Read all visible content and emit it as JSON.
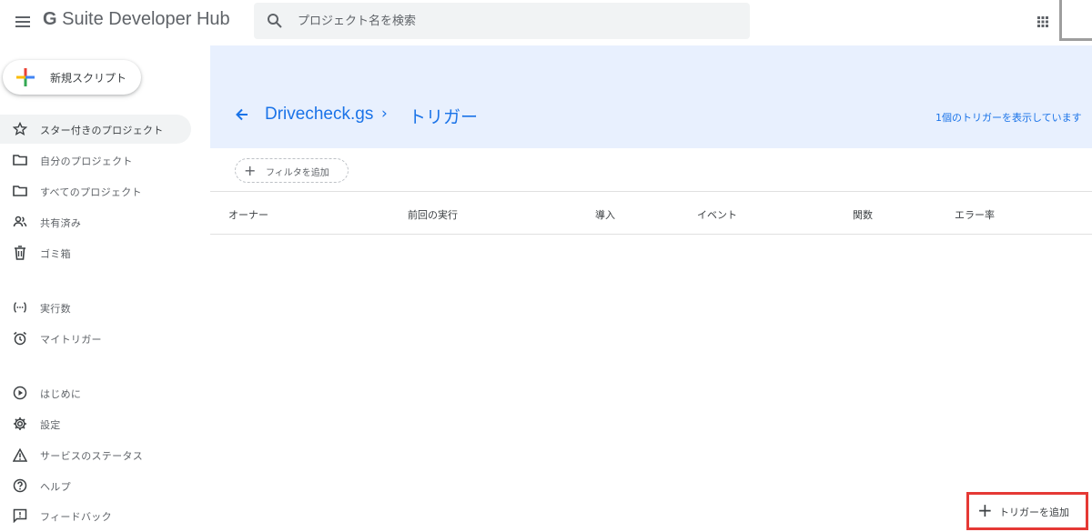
{
  "header": {
    "app_title_g": "G",
    "app_title_rest": "Suite Developer Hub",
    "search_placeholder": "プロジェクト名を検索",
    "icons": {
      "menu": "menu-icon",
      "search": "search-icon",
      "apps": "apps-grid-icon"
    }
  },
  "sidebar": {
    "new_script_label": "新規スクリプト",
    "items": [
      {
        "label": "スター付きのプロジェクト",
        "icon": "star-icon",
        "active": true
      },
      {
        "label": "自分のプロジェクト",
        "icon": "folder-icon"
      },
      {
        "label": "すべてのプロジェクト",
        "icon": "folder-icon"
      },
      {
        "label": "共有済み",
        "icon": "people-icon"
      },
      {
        "label": "ゴミ箱",
        "icon": "trash-icon"
      },
      {
        "label": "実行数",
        "icon": "executions-icon"
      },
      {
        "label": "マイトリガー",
        "icon": "alarm-icon"
      },
      {
        "label": "はじめに",
        "icon": "play-circle-icon"
      },
      {
        "label": "設定",
        "icon": "gear-icon"
      },
      {
        "label": "サービスのステータス",
        "icon": "warning-icon"
      },
      {
        "label": "ヘルプ",
        "icon": "help-icon"
      },
      {
        "label": "フィードバック",
        "icon": "feedback-icon"
      }
    ]
  },
  "main": {
    "breadcrumb": {
      "project": "Drivecheck.gs",
      "separator": "›",
      "current": "トリガー"
    },
    "trigger_count_text": "1個のトリガーを表示しています",
    "filter_label": "フィルタを追加",
    "table": {
      "columns": [
        "オーナー",
        "前回の実行",
        "導入",
        "イベント",
        "関数",
        "エラー率"
      ]
    },
    "add_trigger_label": "トリガーを追加"
  },
  "colors": {
    "accent": "#1a73e8",
    "header_bg": "#e8f0fe",
    "highlight_border": "#e53935"
  }
}
